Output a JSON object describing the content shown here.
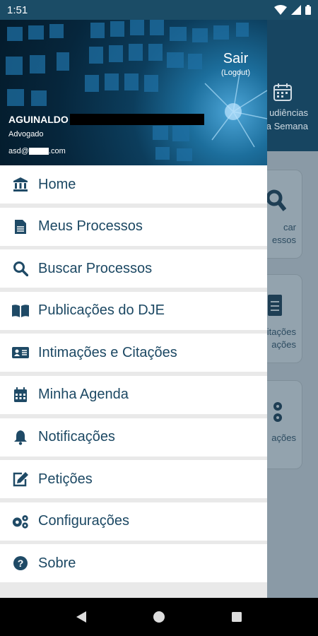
{
  "status_bar": {
    "time": "1:51"
  },
  "background": {
    "agenda_label_line1": "udiências",
    "agenda_label_line2": "a Semana",
    "cards": [
      {
        "line1": "car",
        "line2": "essos"
      },
      {
        "line1": "citações",
        "line2": "ações"
      },
      {
        "line1": "ações",
        "line2": ""
      }
    ]
  },
  "drawer": {
    "logout_label": "Sair",
    "logout_sub": "(Logout)",
    "user_name": "AGUINALDO",
    "user_role": "Advogado",
    "email_prefix": "asd@",
    "email_suffix": ".com",
    "menu": [
      {
        "label": "Home",
        "icon": "bank-icon"
      },
      {
        "label": "Meus Processos",
        "icon": "document-icon"
      },
      {
        "label": "Buscar Processos",
        "icon": "search-icon"
      },
      {
        "label": "Publicações do DJE",
        "icon": "book-open-icon"
      },
      {
        "label": "Intimações e Citações",
        "icon": "id-card-icon"
      },
      {
        "label": "Minha Agenda",
        "icon": "calendar-icon"
      },
      {
        "label": "Notificações",
        "icon": "bell-icon"
      },
      {
        "label": "Petições",
        "icon": "edit-icon"
      },
      {
        "label": "Configurações",
        "icon": "gears-icon"
      },
      {
        "label": "Sobre",
        "icon": "question-circle-icon"
      }
    ]
  },
  "colors": {
    "primary": "#1c4863",
    "icon": "#1f4a66",
    "status_bar": "#1b4c66"
  }
}
